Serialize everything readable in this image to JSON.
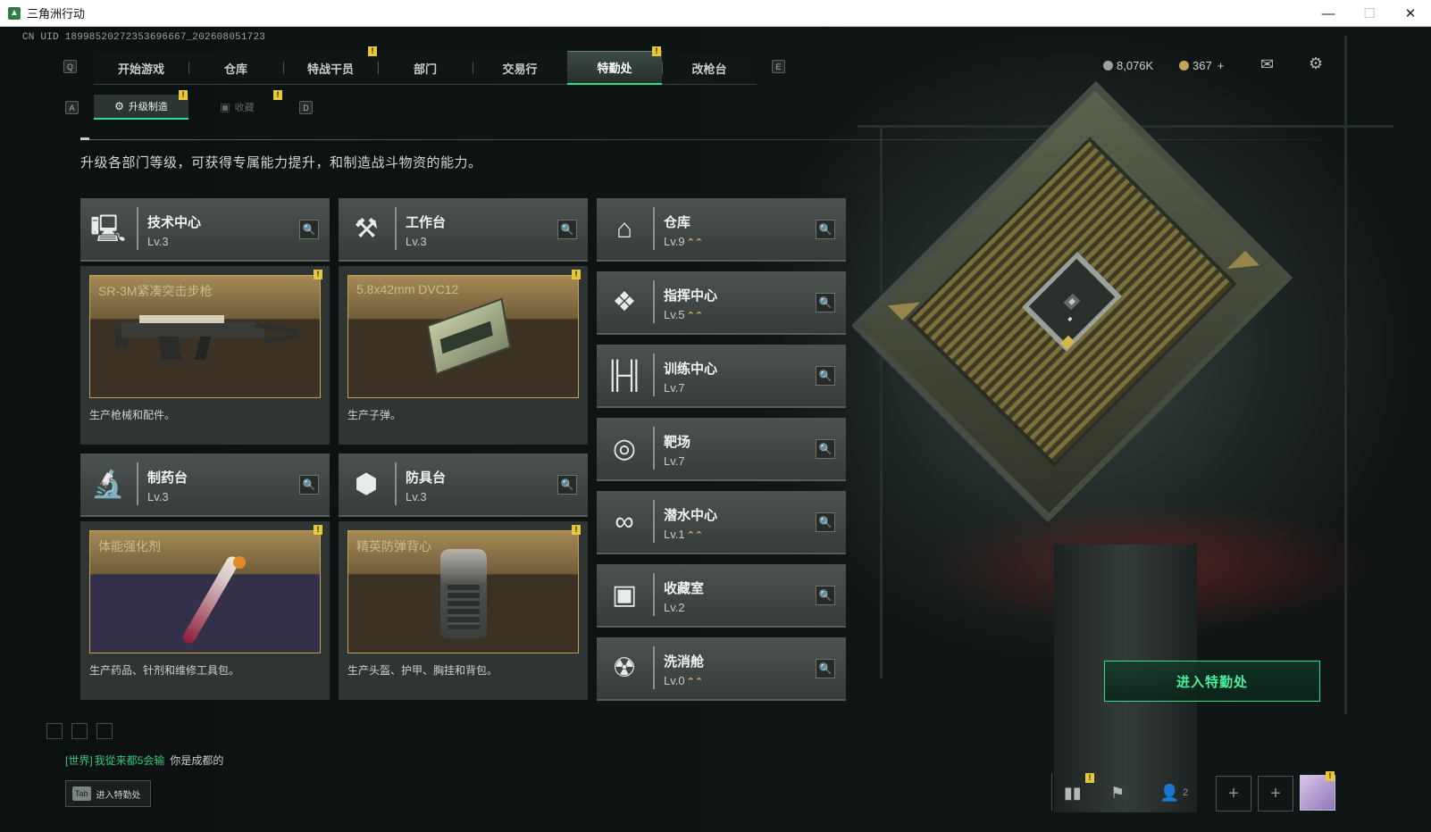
{
  "window": {
    "title": "三角洲行动",
    "minimize": "—",
    "maximize": "☐",
    "close": "✕"
  },
  "uid": "CN UID 18998520272353696667_202608051723",
  "keys": {
    "prev_tab": "Q",
    "next_tab": "E",
    "prev_sub": "A",
    "next_sub": "D"
  },
  "nav": {
    "tabs": [
      {
        "label": "开始游戏",
        "active": false
      },
      {
        "label": "仓库",
        "active": false
      },
      {
        "label": "特战干员",
        "active": false,
        "alert": "!"
      },
      {
        "label": "部门",
        "active": false
      },
      {
        "label": "交易行",
        "active": false
      },
      {
        "label": "特勤处",
        "active": true,
        "alert": "!"
      },
      {
        "label": "改枪台",
        "active": false
      }
    ]
  },
  "subtabs": [
    {
      "label": "升级制造",
      "active": true,
      "alert": "!"
    },
    {
      "label": "收藏",
      "active": false,
      "alert": "!"
    }
  ],
  "description": "升级各部门等级，可获得专属能力提升，和制造战斗物资的能力。",
  "currency": {
    "silver": "8,076K",
    "gold": "367",
    "add": "+"
  },
  "top_icons": {
    "mail": "mail-icon",
    "settings": "gear-icon"
  },
  "big_stations": [
    {
      "name": "技术中心",
      "level": "Lv.3",
      "icon": "monitor-icon",
      "item_name": "SR-3M紧凑突击步枪",
      "item_desc": "生产枪械和配件。",
      "alert": "!"
    },
    {
      "name": "工作台",
      "level": "Lv.3",
      "icon": "hammer-wrench-icon",
      "item_name": "5.8x42mm DVC12",
      "item_desc": "生产子弹。",
      "alert": "!"
    },
    {
      "name": "制药台",
      "level": "Lv.3",
      "icon": "microscope-icon",
      "item_name": "体能强化剂",
      "item_desc": "生产药品、针剂和维修工具包。",
      "alert": "!"
    },
    {
      "name": "防具台",
      "level": "Lv.3",
      "icon": "cubes-icon",
      "item_name": "精英防弹背心",
      "item_desc": "生产头盔、护甲、胸挂和背包。",
      "alert": "!"
    }
  ],
  "side_stations": [
    {
      "name": "仓库",
      "level": "Lv.9",
      "upgrade": "⌃⌃",
      "icon": "warehouse-icon"
    },
    {
      "name": "指挥中心",
      "level": "Lv.5",
      "upgrade": "⌃⌃",
      "icon": "command-chip-icon"
    },
    {
      "name": "训练中心",
      "level": "Lv.7",
      "upgrade": "",
      "icon": "dumbbell-icon"
    },
    {
      "name": "靶场",
      "level": "Lv.7",
      "upgrade": "",
      "icon": "target-icon"
    },
    {
      "name": "潜水中心",
      "level": "Lv.1",
      "upgrade": "⌃⌃",
      "icon": "diving-mask-icon"
    },
    {
      "name": "收藏室",
      "level": "Lv.2",
      "upgrade": "",
      "icon": "display-case-icon"
    },
    {
      "name": "洗消舱",
      "level": "Lv.0",
      "upgrade": "⌃⌃",
      "icon": "hazmat-icon"
    }
  ],
  "enter_button": "进入特勤处",
  "chat": {
    "channel": "[世界]",
    "name": "我從来都5会输",
    "message": "你是成都的"
  },
  "tab_hint": {
    "key": "Tab",
    "label": "进入特勤处"
  },
  "bottom": {
    "friends_count": "2",
    "plus": "+"
  },
  "colors": {
    "accent": "#2ee08d",
    "alert": "#e8c83a",
    "upgrade": "#e2c14f",
    "item_border": "#c79f54"
  }
}
